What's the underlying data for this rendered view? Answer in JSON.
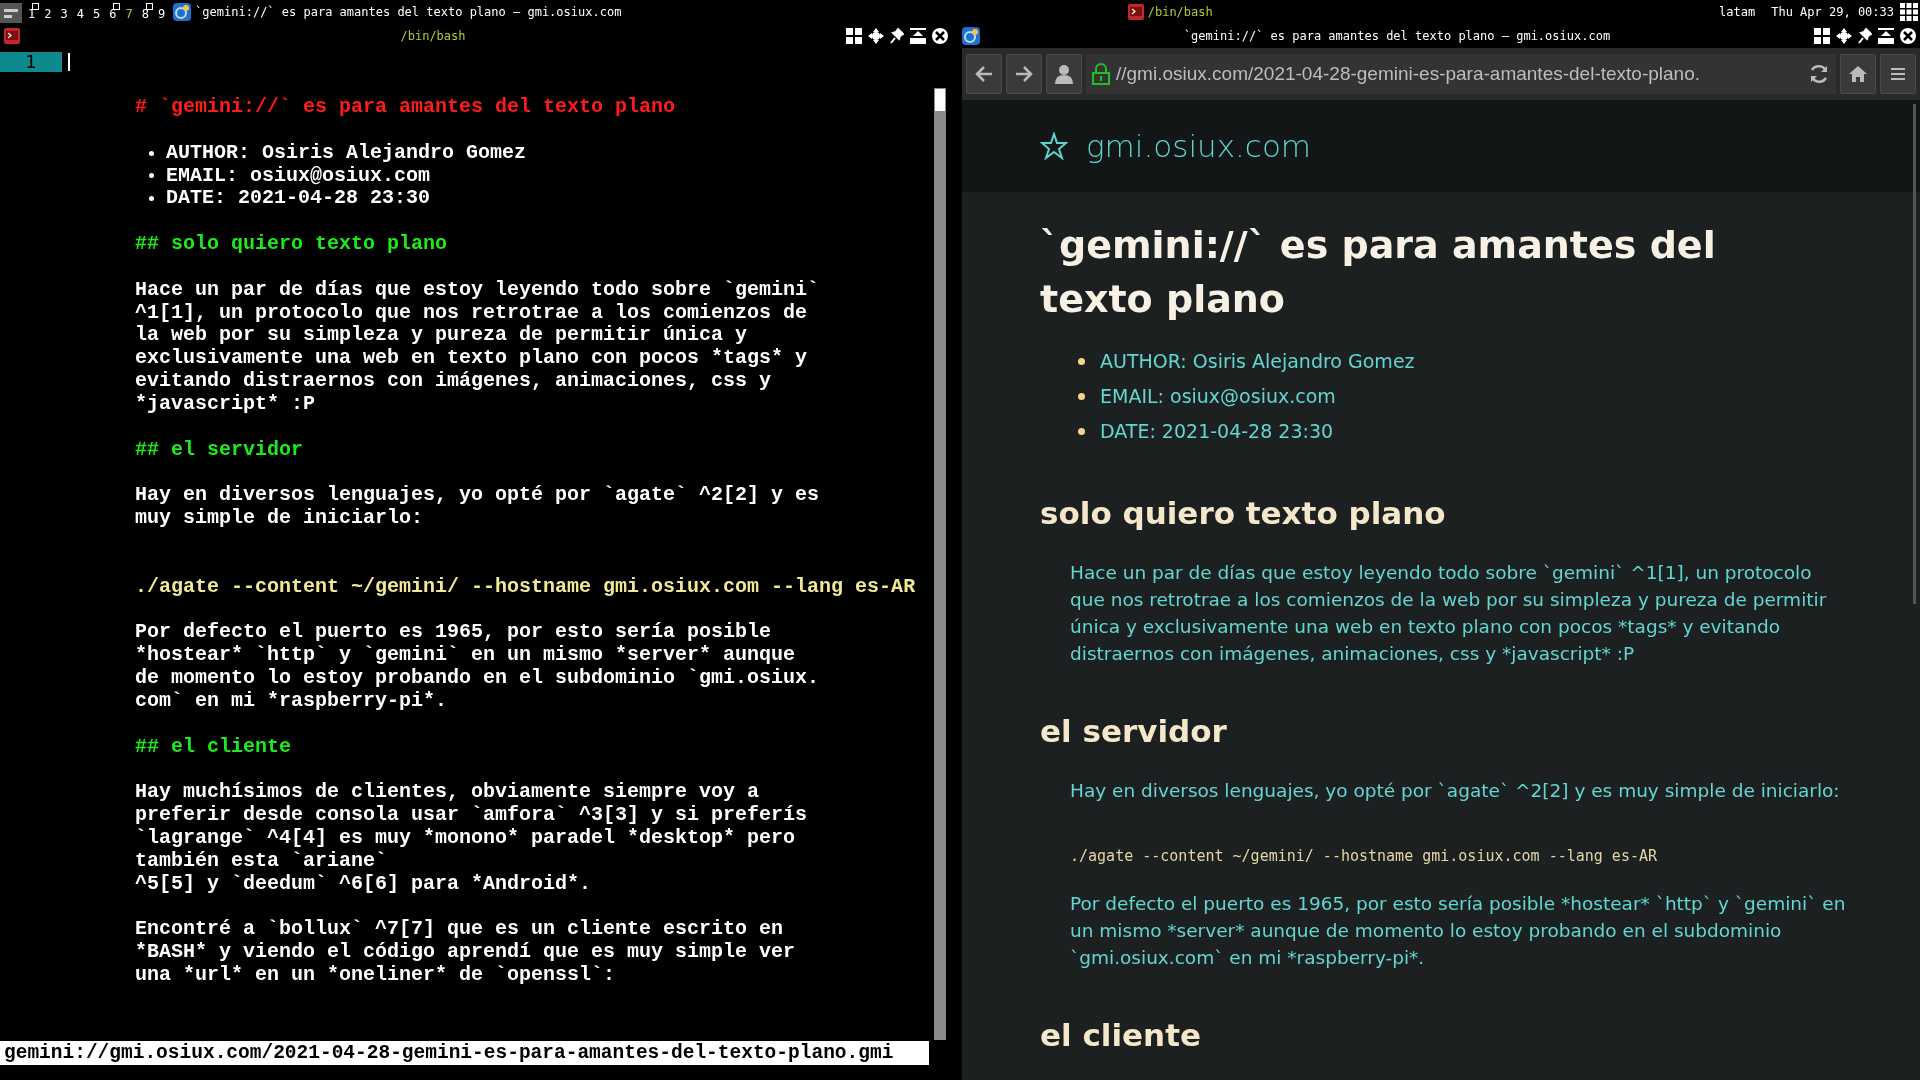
{
  "top_bar": {
    "workspaces": [
      {
        "label": "1",
        "selected": false,
        "occupied": true
      },
      {
        "label": "2",
        "selected": false,
        "occupied": false
      },
      {
        "label": "3",
        "selected": false,
        "occupied": false
      },
      {
        "label": "4",
        "selected": false,
        "occupied": false
      },
      {
        "label": "5",
        "selected": false,
        "occupied": false
      },
      {
        "label": "6",
        "selected": false,
        "occupied": true
      },
      {
        "label": "7",
        "selected": true,
        "occupied": false
      },
      {
        "label": "8",
        "selected": false,
        "occupied": true
      },
      {
        "label": "9",
        "selected": false,
        "occupied": false
      }
    ],
    "active_window_title": "`gemini://` es para amantes del texto plano — gmi.osiux.com",
    "terminal_title": "/bin/bash",
    "keyboard_layout": "latam",
    "clock": "Thu Apr 29, 00:33"
  },
  "terminal": {
    "title": "/bin/bash",
    "tab": "1",
    "lines": [
      {
        "kind": "h1",
        "text": "# `gemini://` es para amantes del texto plano"
      },
      {
        "kind": "blank"
      },
      {
        "kind": "bullet",
        "text": "AUTHOR: Osiris Alejandro Gomez"
      },
      {
        "kind": "bullet",
        "text": "EMAIL: osiux@osiux.com"
      },
      {
        "kind": "bullet",
        "text": "DATE: 2021-04-28 23:30"
      },
      {
        "kind": "blank"
      },
      {
        "kind": "h2",
        "text": "## solo quiero texto plano"
      },
      {
        "kind": "blank"
      },
      {
        "kind": "text",
        "text": "Hace un par de días que estoy leyendo todo sobre `gemini`"
      },
      {
        "kind": "text",
        "text": "^1[1], un protocolo que nos retrotrae a los comienzos de"
      },
      {
        "kind": "text",
        "text": "la web por su simpleza y pureza de permitir única y"
      },
      {
        "kind": "text",
        "text": "exclusivamente una web en texto plano con pocos *tags* y"
      },
      {
        "kind": "text",
        "text": "evitando distraernos con imágenes, animaciones, css y"
      },
      {
        "kind": "text",
        "text": "*javascript* :P"
      },
      {
        "kind": "blank"
      },
      {
        "kind": "h2",
        "text": "## el servidor"
      },
      {
        "kind": "blank"
      },
      {
        "kind": "text",
        "text": "Hay en diversos lenguajes, yo opté por `agate` ^2[2] y es"
      },
      {
        "kind": "text",
        "text": "muy simple de iniciarlo:"
      },
      {
        "kind": "blank"
      },
      {
        "kind": "blank"
      },
      {
        "kind": "code",
        "text": "./agate --content ~/gemini/ --hostname gmi.osiux.com --lang es-AR"
      },
      {
        "kind": "blank"
      },
      {
        "kind": "text",
        "text": "Por defecto el puerto es 1965, por esto sería posible"
      },
      {
        "kind": "text",
        "text": "*hostear* `http` y `gemini` en un mismo *server* aunque"
      },
      {
        "kind": "text",
        "text": "de momento lo estoy probando en el subdominio `gmi.osiux."
      },
      {
        "kind": "text",
        "text": "com` en mi *raspberry-pi*."
      },
      {
        "kind": "blank"
      },
      {
        "kind": "h2",
        "text": "## el cliente"
      },
      {
        "kind": "blank"
      },
      {
        "kind": "text",
        "text": "Hay muchísimos de clientes, obviamente siempre voy a"
      },
      {
        "kind": "text",
        "text": "preferir desde consola usar `amfora` ^3[3] y si preferís"
      },
      {
        "kind": "text",
        "text": "`lagrange` ^4[4] es muy *monono* paradel *desktop* pero"
      },
      {
        "kind": "text",
        "text": "también esta `ariane`"
      },
      {
        "kind": "text",
        "text": "^5[5] y `deedum` ^6[6] para *Android*."
      },
      {
        "kind": "blank"
      },
      {
        "kind": "text",
        "text": "Encontré a `bollux` ^7[7] que es un cliente escrito en"
      },
      {
        "kind": "text",
        "text": "*BASH* y viendo el código aprendí que es muy simple ver"
      },
      {
        "kind": "text",
        "text": "una *url* en un *oneliner* de `openssl`:"
      }
    ],
    "status_line": "gemini://gmi.osiux.com/2021-04-28-gemini-es-para-amantes-del-texto-plano.gmi"
  },
  "browser": {
    "title": "`gemini://` es para amantes del texto plano — gmi.osiux.com",
    "url": "//gmi.osiux.com/2021-04-28-gemini-es-para-amantes-del-texto-plano.",
    "site_name": "gmi.osiux.com",
    "blocks": [
      {
        "kind": "h1",
        "text": "`gemini://` es para amantes del texto plano"
      },
      {
        "kind": "list",
        "items": [
          "AUTHOR: Osiris Alejandro Gomez",
          "EMAIL: osiux@osiux.com",
          "DATE: 2021-04-28 23:30"
        ]
      },
      {
        "kind": "h2",
        "text": "solo quiero texto plano"
      },
      {
        "kind": "p",
        "text": "Hace un par de días que estoy leyendo todo sobre `gemini` ^1[1], un protocolo que nos retrotrae a los comienzos de la web por su simpleza y pureza de permitir única y exclusivamente una web en texto plano con pocos *tags* y evitando distraernos con imágenes, animaciones, css y *javascript* :P"
      },
      {
        "kind": "h2",
        "text": "el servidor"
      },
      {
        "kind": "p",
        "text": "Hay en diversos lenguajes, yo opté por `agate` ^2[2] y es muy simple de iniciarlo:"
      },
      {
        "kind": "code",
        "text": "./agate --content ~/gemini/ --hostname gmi.osiux.com --lang es-AR"
      },
      {
        "kind": "p",
        "text": "Por defecto el puerto es 1965, por esto sería posible *hostear* `http` y `gemini` en un mismo *server* aunque de momento lo estoy probando en el subdominio `gmi.osiux.com` en mi *raspberry-pi*."
      },
      {
        "kind": "h2",
        "text": "el cliente"
      }
    ]
  }
}
